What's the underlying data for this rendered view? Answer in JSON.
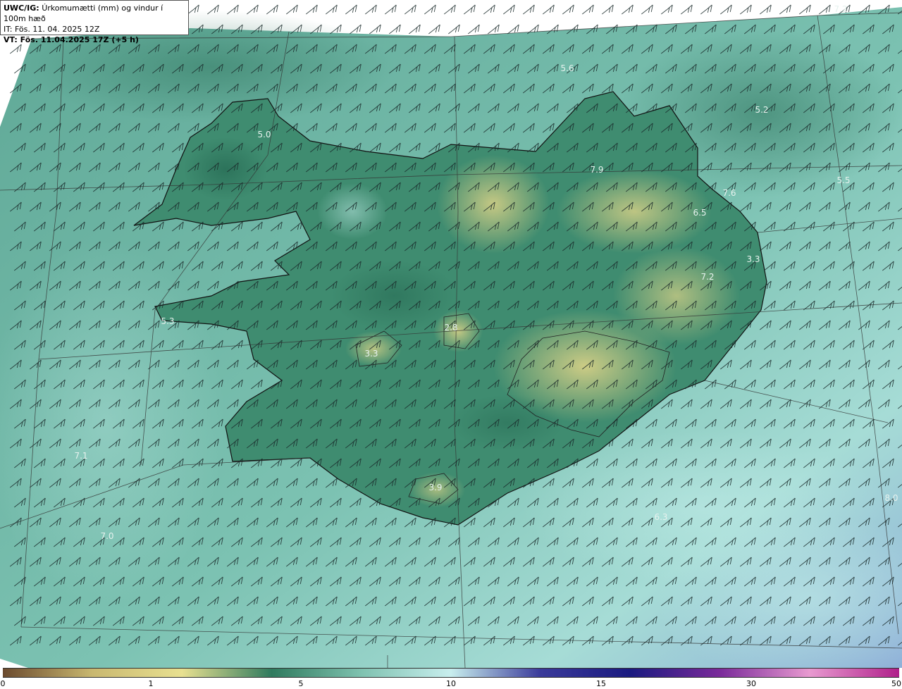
{
  "header": {
    "model": "UWC/IG:",
    "title": "Úrkomumætti (mm) og vindur í 100m hæð",
    "it_line": "IT: Fös. 11. 04. 2025 12Z",
    "vt_line": "VT: Fös. 11.04.2025 17Z (+5 h)"
  },
  "map_labels": [
    {
      "text": "7.2"
    },
    {
      "text": "5.6"
    },
    {
      "text": "5.2"
    },
    {
      "text": "5.0"
    },
    {
      "text": "7.9"
    },
    {
      "text": "7.6"
    },
    {
      "text": "5.5"
    },
    {
      "text": "6.5"
    },
    {
      "text": "3.3"
    },
    {
      "text": "7.2"
    },
    {
      "text": "2.8"
    },
    {
      "text": "3.3"
    },
    {
      "text": "3.9"
    },
    {
      "text": "7.1"
    },
    {
      "text": "7.0"
    },
    {
      "text": "8.0"
    },
    {
      "text": "6.3"
    },
    {
      "text": "5.3"
    }
  ],
  "colorbar": {
    "ticks": [
      "0",
      "1",
      "5",
      "10",
      "15",
      "30",
      "50"
    ],
    "colors": [
      "#6b4a2e",
      "#c9b870",
      "#e8e090",
      "#2f7a5e",
      "#7fc2b0",
      "#c8eeee",
      "#3a3a9a",
      "#1a1a80",
      "#7a2a9a",
      "#e89ad0",
      "#b0208a"
    ]
  },
  "colors": {
    "sea": "#6db6a8",
    "land_dark": "#2e7a5e",
    "land_yellow": "#c9c77a",
    "coast": "#111111",
    "grid": "#333333",
    "barb": "#1a2a2a"
  }
}
